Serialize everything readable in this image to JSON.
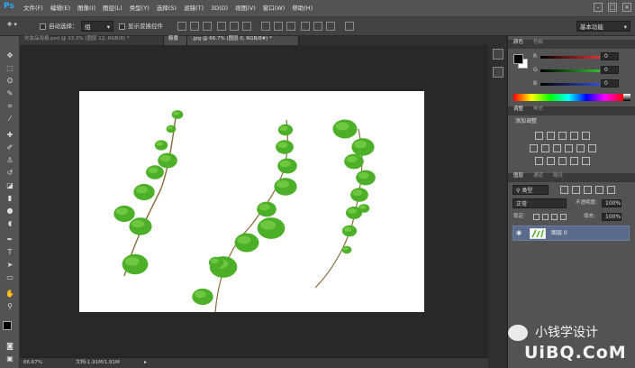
{
  "app": {
    "logo": "Ps"
  },
  "menu": [
    "文件(F)",
    "编辑(E)",
    "图像(I)",
    "图层(L)",
    "类型(Y)",
    "选择(S)",
    "滤镜(T)",
    "3D(D)",
    "视图(V)",
    "窗口(W)",
    "帮助(H)"
  ],
  "window_controls": [
    "–",
    "□",
    "×"
  ],
  "options": {
    "auto_select_label": "自动选择：",
    "auto_select_value": "组",
    "show_transform_label": "显示变换控件",
    "workspace": "基本功能"
  },
  "tabs": [
    {
      "label": "化妆品海报.psd @ 33.3% (图层 12, RGB/8) *",
      "active": false
    },
    {
      "label": "藤蔓",
      "active": true
    },
    {
      "label": ".jpg @ 66.7% (图层 0, RGB/8#) *",
      "active": true
    }
  ],
  "status": {
    "zoom": "66.67%",
    "doc": "文档:1.91M/1.91M"
  },
  "color_panel": {
    "tabs": [
      "颜色",
      "色板"
    ],
    "channels": [
      {
        "label": "R",
        "value": "0",
        "color": "#e03030"
      },
      {
        "label": "G",
        "value": "0",
        "color": "#30c030"
      },
      {
        "label": "B",
        "value": "0",
        "color": "#3050e0"
      }
    ]
  },
  "adjust_panel": {
    "tabs": [
      "调整",
      "样式"
    ],
    "title": "添加调整"
  },
  "layers_panel": {
    "tabs": [
      "图层",
      "通道",
      "路径"
    ],
    "filter_label": "类型",
    "blend_mode": "正常",
    "opacity_label": "不透明度:",
    "opacity_value": "100%",
    "lock_label": "锁定:",
    "fill_label": "填充:",
    "fill_value": "100%",
    "layer_name": "图层 0"
  },
  "watermark": {
    "brand": "小钱学设计",
    "site": "UiBQ.CoM"
  },
  "colors": {
    "accent_blue": "#31a8ff",
    "leaf_green": "#4caf28",
    "selected_layer": "#5b6b8c"
  }
}
